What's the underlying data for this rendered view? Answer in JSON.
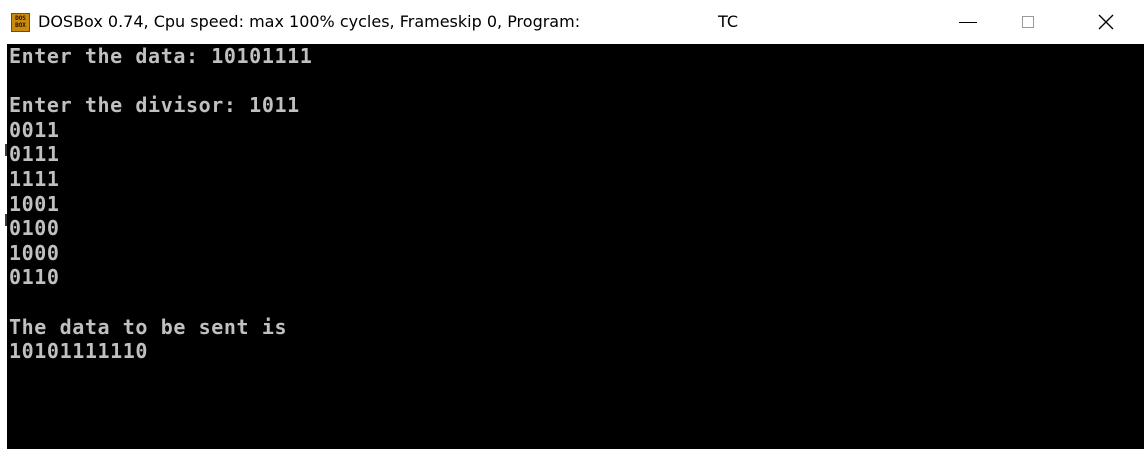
{
  "window": {
    "icon_label": "DOS BOX",
    "title": "DOSBox 0.74, Cpu speed: max 100% cycles, Frameskip  0, Program:",
    "program": "TC"
  },
  "terminal": {
    "background": "#000000",
    "text_color": "#c0c0c0",
    "lines": [
      "Enter the data: 10101111",
      "",
      "Enter the divisor: 1011",
      "0011",
      "0111",
      "1111",
      "1001",
      "0100",
      "1000",
      "0110",
      "",
      "The data to be sent is",
      "10101111110"
    ]
  },
  "icons": {
    "app": "dosbox-app-icon",
    "minimize": "minimize-icon",
    "maximize": "maximize-icon",
    "close": "close-icon"
  }
}
